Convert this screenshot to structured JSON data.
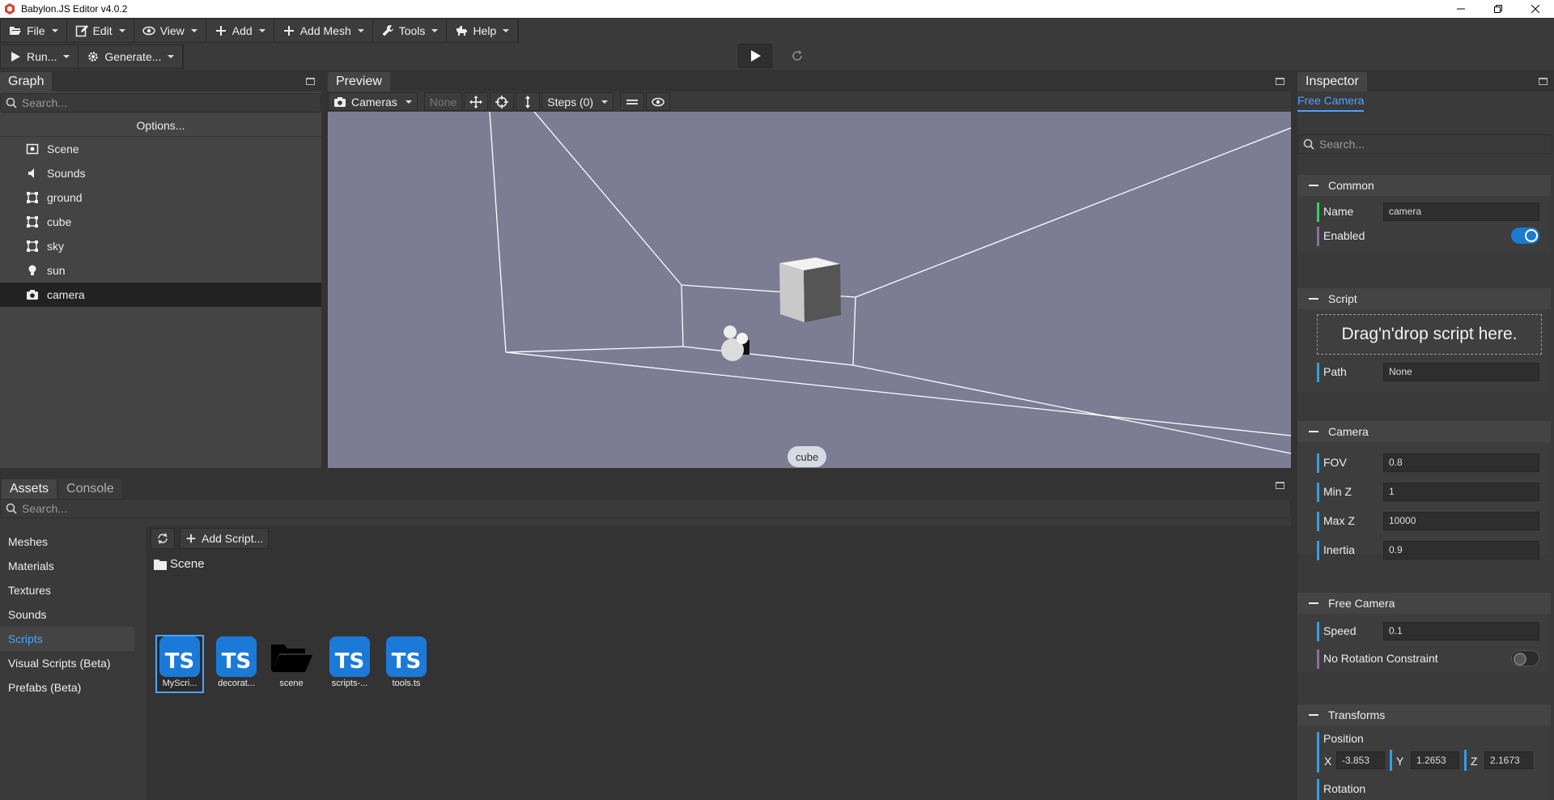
{
  "window": {
    "title": "Babylon.JS Editor v4.0.2",
    "accent": "#d6402f"
  },
  "menubar": {
    "items": [
      {
        "label": "File",
        "icon": "folder-open-icon"
      },
      {
        "label": "Edit",
        "icon": "edit-icon"
      },
      {
        "label": "View",
        "icon": "eye-icon"
      },
      {
        "label": "Add",
        "icon": "plus-icon"
      },
      {
        "label": "Add Mesh",
        "icon": "plus-icon"
      },
      {
        "label": "Tools",
        "icon": "wrench-icon"
      },
      {
        "label": "Help",
        "icon": "dog-icon"
      }
    ]
  },
  "toolbar": {
    "run_label": "Run...",
    "generate_label": "Generate..."
  },
  "graph": {
    "tab": "Graph",
    "search_placeholder": "Search...",
    "options_label": "Options...",
    "items": [
      {
        "label": "Scene",
        "icon": "scene-icon"
      },
      {
        "label": "Sounds",
        "icon": "speaker-icon"
      },
      {
        "label": "ground",
        "icon": "mesh-icon"
      },
      {
        "label": "cube",
        "icon": "mesh-icon"
      },
      {
        "label": "sky",
        "icon": "mesh-icon"
      },
      {
        "label": "sun",
        "icon": "lightbulb-icon"
      },
      {
        "label": "camera",
        "icon": "camera-icon"
      }
    ],
    "selected": "camera"
  },
  "preview": {
    "tab": "Preview",
    "cameras_label": "Cameras",
    "none_label": "None",
    "steps_label": "Steps (0)",
    "hover_label": "cube",
    "viewport_color": "#7c7c93"
  },
  "inspector": {
    "tab": "Inspector",
    "subtab": "Free Camera",
    "search_placeholder": "Search...",
    "common": {
      "title": "Common",
      "name_label": "Name",
      "name_value": "camera",
      "enabled_label": "Enabled",
      "enabled": true
    },
    "script": {
      "title": "Script",
      "drop_label": "Drag'n'drop script here.",
      "path_label": "Path",
      "path_value": "None"
    },
    "camera": {
      "title": "Camera",
      "fov_label": "FOV",
      "fov_value": "0.8",
      "minz_label": "Min Z",
      "minz_value": "1",
      "maxz_label": "Max Z",
      "maxz_value": "10000",
      "inertia_label": "Inertia",
      "inertia_value": "0.9"
    },
    "free_camera": {
      "title": "Free Camera",
      "speed_label": "Speed",
      "speed_value": "0.1",
      "norot_label": "No Rotation Constraint",
      "norot": false
    },
    "transforms": {
      "title": "Transforms",
      "position_label": "Position",
      "x_label": "X",
      "x_value": "-3.853",
      "y_label": "Y",
      "y_value": "1.2653",
      "z_label": "Z",
      "z_value": "2.1673",
      "rotation_label": "Rotation"
    },
    "accent": "#4aa3ff"
  },
  "assets": {
    "tabs": [
      "Assets",
      "Console"
    ],
    "search_placeholder": "Search...",
    "categories": [
      "Meshes",
      "Materials",
      "Textures",
      "Sounds",
      "Scripts",
      "Visual Scripts (Beta)",
      "Prefabs (Beta)"
    ],
    "selected_category": "Scripts",
    "add_script_label": "Add Script...",
    "folder_label": "Scene",
    "files": [
      {
        "label": "MyScri...",
        "kind": "TS",
        "selected": true
      },
      {
        "label": "decorat...",
        "kind": "TS"
      },
      {
        "label": "scene",
        "kind": "folder"
      },
      {
        "label": "scripts-...",
        "kind": "TS"
      },
      {
        "label": "tools.ts",
        "kind": "TS"
      }
    ]
  }
}
